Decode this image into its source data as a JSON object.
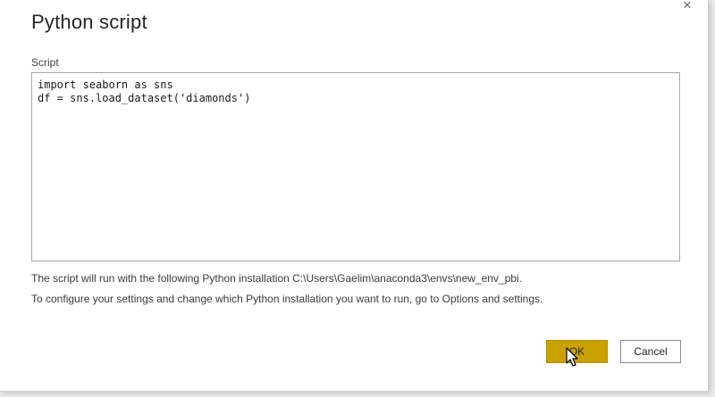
{
  "dialog": {
    "title": "Python script",
    "close_glyph": "×",
    "script_label": "Script",
    "script_lines": [
      "import seaborn as sns",
      "df = sns.load_dataset('diamonds')"
    ],
    "info_line_1": "The script will run with the following Python installation C:\\Users\\Gaelim\\anaconda3\\envs\\new_env_pbi.",
    "info_line_2": "To configure your settings and change which Python installation you want to run, go to Options and settings.",
    "ok_label": "OK",
    "cancel_label": "Cancel"
  },
  "colors": {
    "ok_button": "#c9a100",
    "dialog_background": "#ffffff",
    "editor_border": "#a6a6a6"
  },
  "icons": {
    "close": "close-icon",
    "cursor": "mouse-pointer-icon"
  }
}
